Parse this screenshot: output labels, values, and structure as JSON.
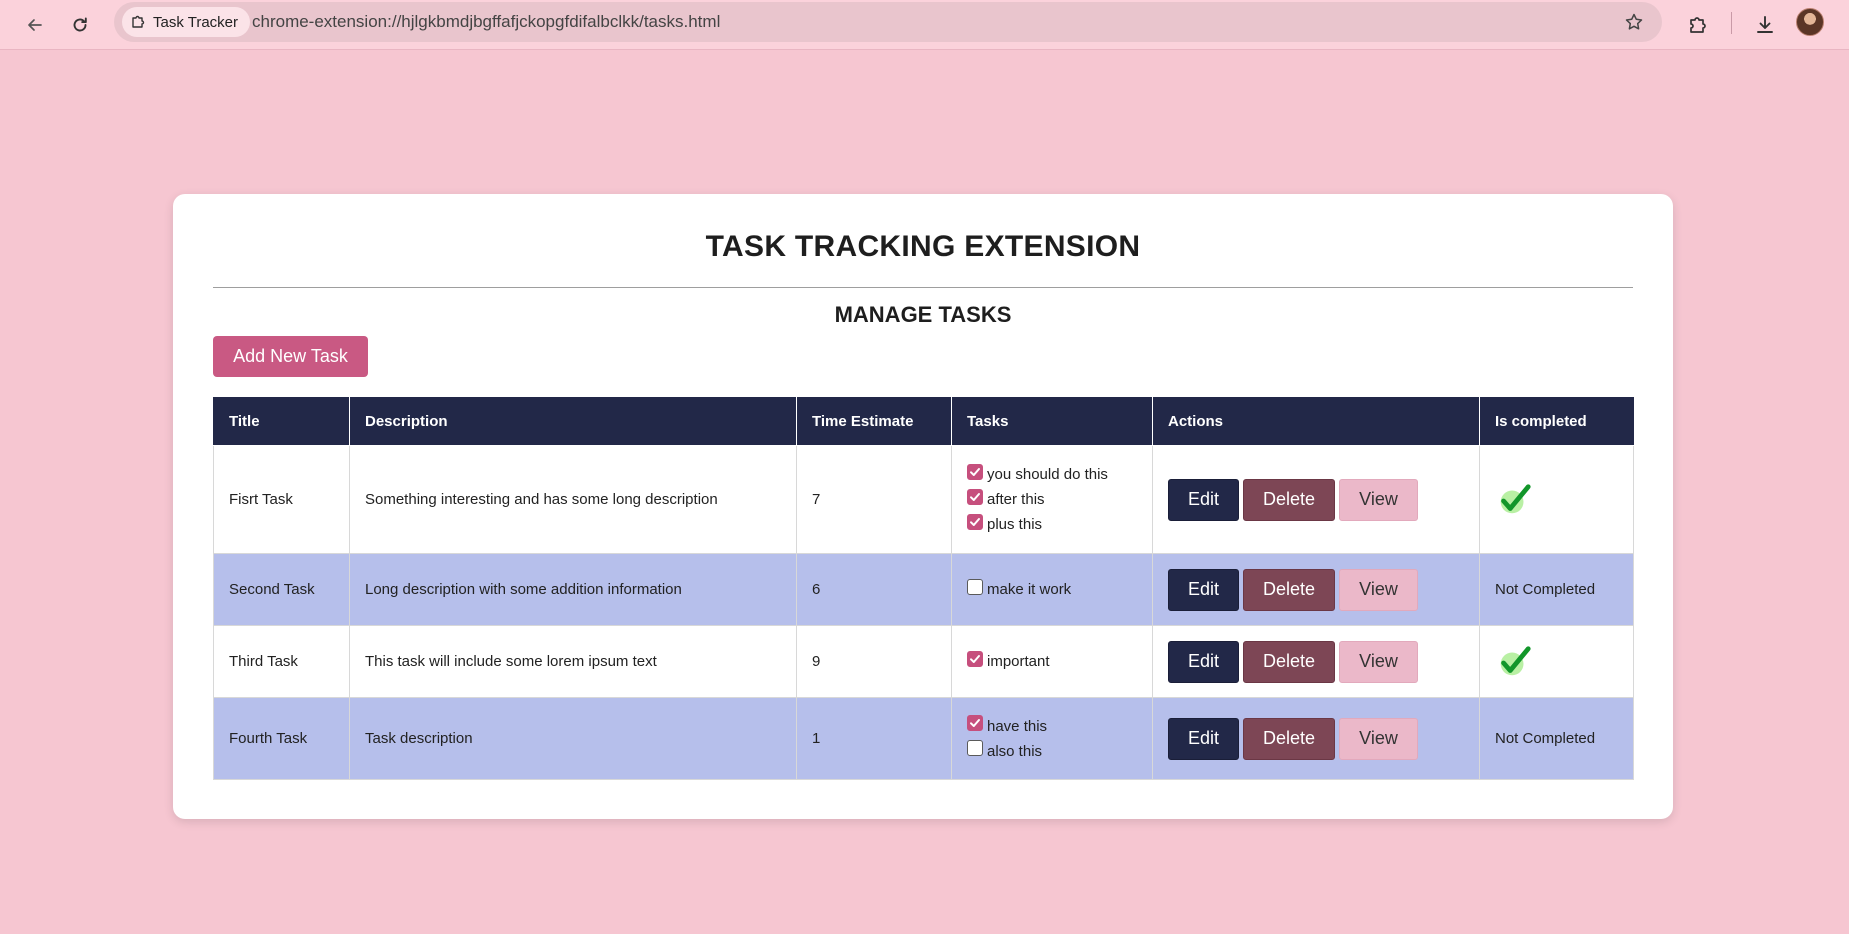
{
  "browser": {
    "tab_title": "Task Tracker",
    "url": "chrome-extension://hjlgkbmdjbgffafjckopgfdifalbclkk/tasks.html"
  },
  "page": {
    "title": "TASK TRACKING EXTENSION",
    "subtitle": "MANAGE TASKS",
    "add_button": "Add New Task"
  },
  "table": {
    "headers": [
      "Title",
      "Description",
      "Time Estimate",
      "Tasks",
      "Actions",
      "Is completed"
    ],
    "rows": [
      {
        "title": "Fisrt Task",
        "description": "Something interesting and has some long description",
        "time_estimate": "7",
        "subtasks": [
          {
            "label": "you should do this",
            "checked": true
          },
          {
            "label": "after this",
            "checked": true
          },
          {
            "label": "plus this",
            "checked": true
          }
        ],
        "completed": true,
        "completed_text": ""
      },
      {
        "title": "Second Task",
        "description": "Long description with some addition information",
        "time_estimate": "6",
        "subtasks": [
          {
            "label": "make it work",
            "checked": false
          }
        ],
        "completed": false,
        "completed_text": "Not Completed"
      },
      {
        "title": "Third Task",
        "description": "This task will include some lorem ipsum text",
        "time_estimate": "9",
        "subtasks": [
          {
            "label": "important",
            "checked": true
          }
        ],
        "completed": true,
        "completed_text": ""
      },
      {
        "title": "Fourth Task",
        "description": "Task description",
        "time_estimate": "1",
        "subtasks": [
          {
            "label": "have this",
            "checked": true
          },
          {
            "label": "also this",
            "checked": false
          }
        ],
        "completed": false,
        "completed_text": "Not Completed"
      }
    ],
    "actions": {
      "edit": "Edit",
      "delete": "Delete",
      "view": "View"
    }
  },
  "colors": {
    "page_background": "#f6c6d1",
    "header_navy": "#222848",
    "accent_pink": "#c95983",
    "row_alt_blue": "#b6bfeb",
    "delete_maroon": "#7d4655",
    "view_pink": "#ebb8c9",
    "check_green": "#1a9e2f"
  },
  "icons": {
    "back": "back-arrow-icon",
    "reload": "reload-icon",
    "site": "puzzle-icon",
    "bookmark": "star-icon",
    "extensions": "puzzle-icon",
    "downloads": "download-icon",
    "completed": "green-check-icon"
  }
}
